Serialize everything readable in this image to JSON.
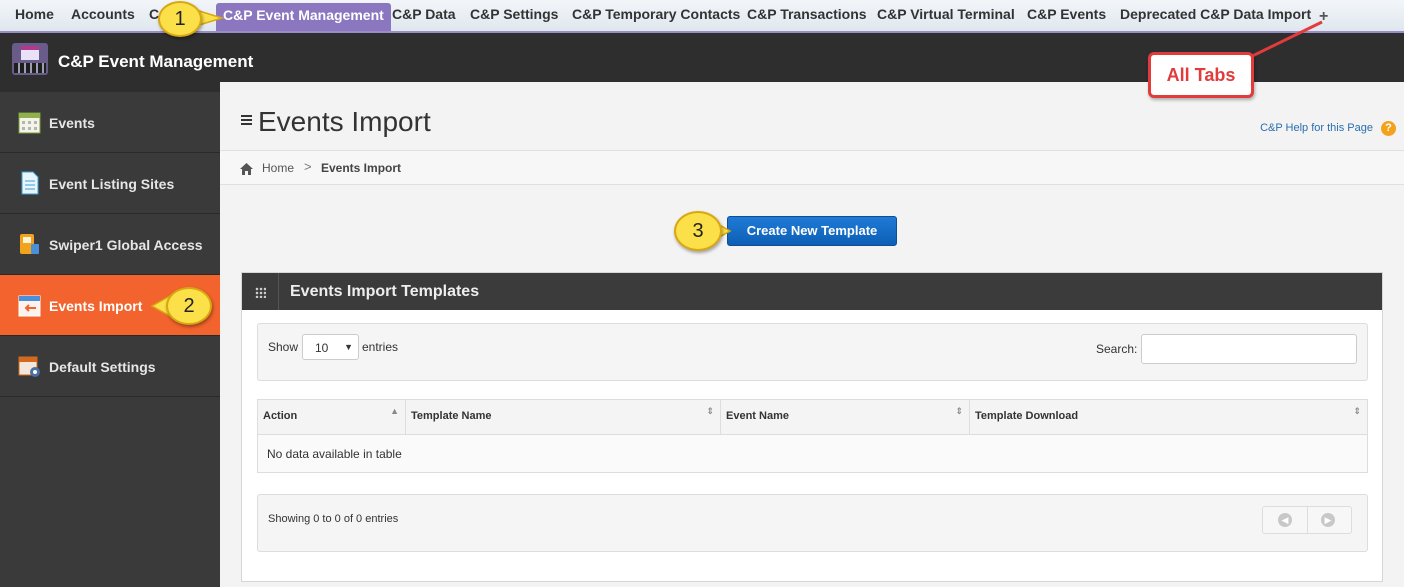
{
  "tabs": [
    {
      "label": "Home"
    },
    {
      "label": "Accounts"
    },
    {
      "label": "C"
    },
    {
      "label": "C&P Event Management"
    },
    {
      "label": "C&P Data"
    },
    {
      "label": "C&P Settings"
    },
    {
      "label": "C&P Temporary Contacts"
    },
    {
      "label": "C&P Transactions"
    },
    {
      "label": "C&P Virtual Terminal"
    },
    {
      "label": "C&P Events"
    },
    {
      "label": "Deprecated C&P Data Import"
    }
  ],
  "tabs_plus": "+",
  "app": {
    "title": "C&P Event Management"
  },
  "sidebar": {
    "items": [
      {
        "label": "Events",
        "icon": "calendar-icon"
      },
      {
        "label": "Event Listing Sites",
        "icon": "document-icon"
      },
      {
        "label": "Swiper1 Global Access",
        "icon": "card-reader-icon"
      },
      {
        "label": "Events Import",
        "icon": "calendar-import-icon"
      },
      {
        "label": "Default Settings",
        "icon": "calendar-settings-icon"
      }
    ]
  },
  "page": {
    "title": "Events Import",
    "help_link": "C&P Help for this Page",
    "help_icon": "?"
  },
  "breadcrumb": {
    "home": "Home",
    "separator": ">",
    "current": "Events Import"
  },
  "create_button": "Create New Template",
  "panel": {
    "title": "Events Import Templates",
    "show_label": "Show",
    "show_value": "10",
    "entries_label": "entries",
    "search_label": "Search:",
    "columns": [
      "Action",
      "Template Name",
      "Event Name",
      "Template Download"
    ],
    "empty_message": "No data available in table",
    "footer_info": "Showing 0 to 0 of 0 entries"
  },
  "annotations": {
    "callout_1": "1",
    "callout_2": "2",
    "callout_3": "3",
    "all_tabs": "All Tabs"
  },
  "colors": {
    "active_tab": "#8b77c0",
    "active_sidebar": "#f2632d",
    "primary_button": "#1f7ad6",
    "callout": "#fbe04a",
    "annotation_red": "#e23b3b"
  }
}
